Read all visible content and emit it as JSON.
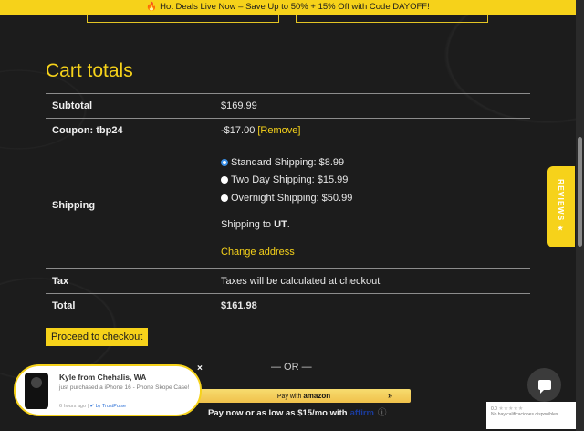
{
  "promo": {
    "fire_icon": "fire-icon",
    "text": "Hot Deals Live Now – Save Up to 50% + 15% Off with Code DAYOFF!"
  },
  "cart": {
    "title": "Cart totals",
    "subtotal_label": "Subtotal",
    "subtotal_value": "$169.99",
    "coupon_label": "Coupon: tbp24",
    "coupon_value": "-$17.00",
    "coupon_remove": "[Remove]",
    "shipping_label": "Shipping",
    "shipping_options": [
      {
        "label": "Standard Shipping: $8.99",
        "checked": true
      },
      {
        "label": "Two Day Shipping: $15.99",
        "checked": false
      },
      {
        "label": "Overnight Shipping: $50.99",
        "checked": false
      }
    ],
    "shipping_to_prefix": "Shipping to ",
    "shipping_to_state": "UT",
    "shipping_to_suffix": ".",
    "change_address": "Change address",
    "tax_label": "Tax",
    "tax_value": "Taxes will be calculated at checkout",
    "total_label": "Total",
    "total_value": "$161.98"
  },
  "checkout": {
    "proceed_label": "Proceed to checkout",
    "or_label": "— OR —",
    "amazon_prefix": "Pay with",
    "amazon_brand": "amazon",
    "amazon_arrows": "»",
    "affirm_text": "Pay now or as low as $15/mo with",
    "affirm_brand": "affirm",
    "affirm_help": "ⓘ"
  },
  "reviews_tab": {
    "label": "REVIEWS ★"
  },
  "trustpulse": {
    "name": "Kyle from Chehalis, WA",
    "description": "just purchased a iPhone 16 - Phone Skope Case!",
    "time": "6 hours ago",
    "by": "by TrustPulse",
    "close": "×"
  },
  "rating_widget": {
    "score": "0.0",
    "stars": "★★★★★",
    "text": "No hay calificaciones disponibles"
  },
  "colors": {
    "accent": "#f6d21a",
    "background": "#1c1c1c"
  }
}
